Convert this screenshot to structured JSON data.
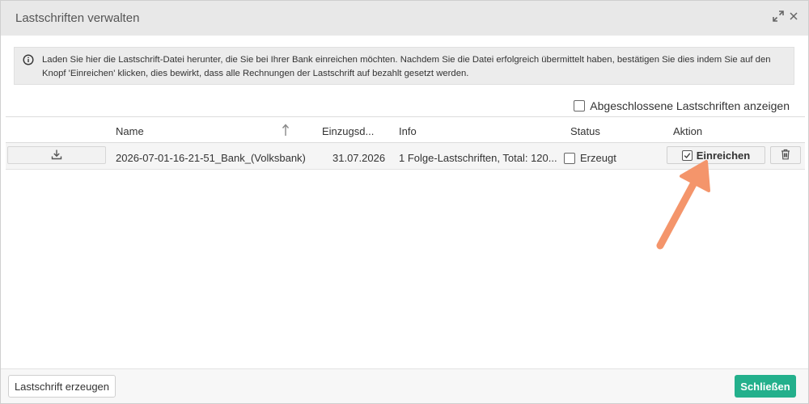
{
  "dialog": {
    "title": "Lastschriften verwalten",
    "icons": [
      "expand-icon",
      "close-icon"
    ]
  },
  "info": {
    "icon": "info-icon",
    "text": "Laden Sie hier die Lastschrift-Datei herunter, die Sie bei Ihrer Bank einreichen möchten. Nachdem Sie die Datei erfolgreich übermittelt haben, bestätigen Sie dies indem Sie auf den Knopf 'Einreichen' klicken, dies bewirkt, dass alle Rechnungen der Lastschrift auf bezahlt gesetzt werden."
  },
  "filter": {
    "show_closed_label": "Abgeschlossene Lastschriften anzeigen",
    "show_closed_checked": false
  },
  "table": {
    "columns": {
      "name": "Name",
      "due_date": "Einzugsd...",
      "info": "Info",
      "status": "Status",
      "action": "Aktion"
    },
    "sort_icon": "sort-ascending-icon",
    "rows": [
      {
        "name": "2026-07-01-16-21-51_Bank_(Volksbank)",
        "due_date": "31.07.2026",
        "info": "1 Folge-Lastschriften, Total: 120...",
        "status": "Erzeugt",
        "status_checked": false,
        "submit_label": "Einreichen"
      }
    ]
  },
  "footer": {
    "generate_label": "Lastschrift erzeugen",
    "close_label": "Schließen"
  },
  "colors": {
    "primary": "#23b08c",
    "annotation_arrow": "#f4956b"
  }
}
